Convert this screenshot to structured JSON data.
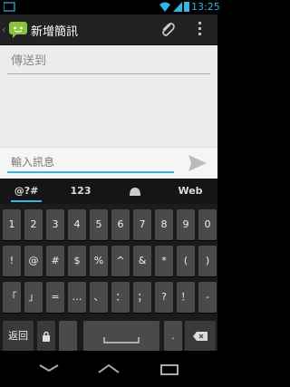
{
  "status": {
    "time": "13:25",
    "accent": "#33b5e5"
  },
  "actionbar": {
    "title": "新增簡訊",
    "up_glyph": "‹"
  },
  "compose": {
    "to_placeholder": "傳送到",
    "message_placeholder": "輸入訊息"
  },
  "keyboard": {
    "tabs": [
      "@?#",
      "123",
      "",
      "Web"
    ],
    "rows": [
      [
        "1",
        "2",
        "3",
        "4",
        "5",
        "6",
        "7",
        "8",
        "9",
        "0"
      ],
      [
        "!",
        "@",
        "#",
        "$",
        "%",
        "^",
        "&",
        "*",
        "(",
        ")"
      ],
      [
        "「",
        "」",
        "=",
        "…",
        "、",
        "：",
        "；",
        "?",
        "！",
        "-"
      ]
    ],
    "bottom": {
      "back_label": "返回",
      "dot": "."
    }
  }
}
